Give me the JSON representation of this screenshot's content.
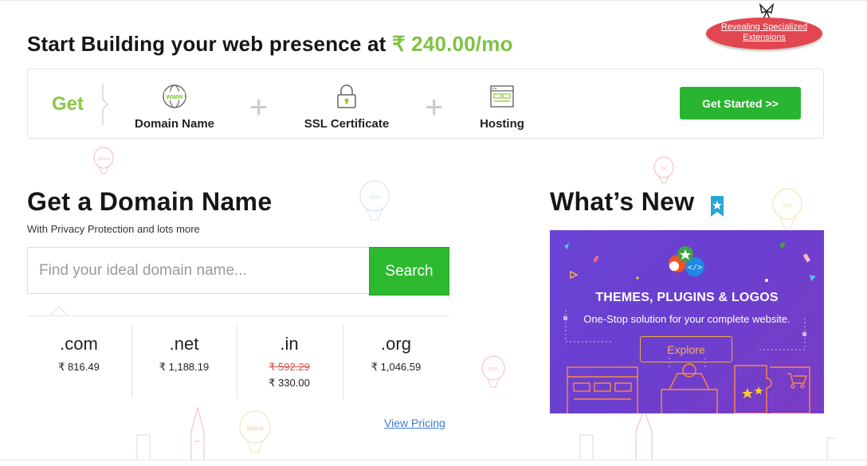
{
  "header": {
    "headline_prefix": "Start Building your web presence at ",
    "headline_price": "₹ 240.00/mo",
    "promo_label": "Revealing Specialized Extensions"
  },
  "get_box": {
    "get_label": "Get",
    "items": [
      {
        "label": "Domain Name",
        "icon": "www-globe-icon"
      },
      {
        "label": "SSL Certificate",
        "icon": "padlock-icon"
      },
      {
        "label": "Hosting",
        "icon": "browser-window-icon"
      }
    ],
    "plus": "+",
    "cta_label": "Get Started >>"
  },
  "domain": {
    "title": "Get a Domain Name",
    "subtitle": "With Privacy Protection and lots more",
    "search_placeholder": "Find your ideal domain name...",
    "search_button": "Search",
    "tlds": [
      {
        "name": ".com",
        "price": "₹ 816.49"
      },
      {
        "name": ".net",
        "price": "₹ 1,188.19"
      },
      {
        "name": ".in",
        "old_price": "₹ 592.29",
        "price": "₹ 330.00"
      },
      {
        "name": ".org",
        "price": "₹ 1,046.59"
      }
    ],
    "view_pricing": "View Pricing"
  },
  "whats_new": {
    "title": "What’s New",
    "banner_title": "THEMES, PLUGINS & LOGOS",
    "banner_subtitle": "One-Stop solution for your complete website.",
    "explore_label": "Explore"
  },
  "colors": {
    "accent_green": "#7dc243",
    "button_green": "#29b530",
    "promo_red": "#e2474f",
    "banner_purple": "#6b44d6",
    "link_blue": "#3d7bd6"
  },
  "decor_balloon_labels": [
    "space",
    "site",
    "net",
    "org",
    "com",
    "space"
  ]
}
